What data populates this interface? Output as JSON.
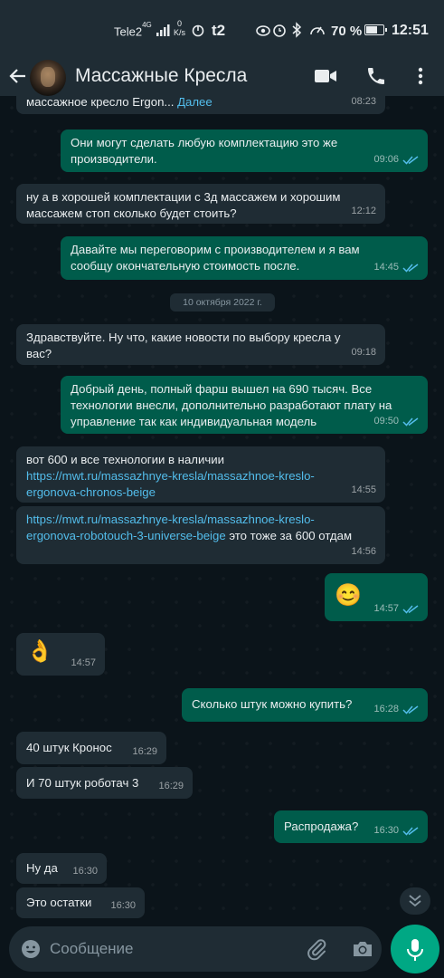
{
  "status_bar": {
    "carrier": "Tele2",
    "network": "4G",
    "speed_value": "0",
    "speed_unit": "K/s",
    "operator2": "t2",
    "battery_percent_label": "70 %",
    "battery_level": 0.7,
    "time": "12:51"
  },
  "header": {
    "title": "Массажные Кресла",
    "icons": [
      "back-arrow-icon",
      "avatar",
      "video-call-icon",
      "phone-icon",
      "menu-dots-icon"
    ]
  },
  "chat": {
    "date_chip": "10 октября 2022 г.",
    "messages": [
      {
        "dir": "in",
        "text": "массажное кресло Ergon... ",
        "link": "Далее",
        "time": "08:23"
      },
      {
        "dir": "out",
        "text": "Они могут сделать любую комплектацию это же производители.",
        "time": "09:06"
      },
      {
        "dir": "in",
        "text": "ну а в хорошей комплектации с 3д массажем и хорошим массажем стоп сколько будет стоить?",
        "time": "12:12"
      },
      {
        "dir": "out",
        "text": "Давайте мы переговорим с производителем и я вам сообщу окончательную стоимость после.",
        "time": "14:45"
      },
      {
        "dir": "in",
        "text": "Здравствуйте. Ну что, какие новости по выбору кресла у вас?",
        "time": "09:18"
      },
      {
        "dir": "out",
        "text": "Добрый день, полный фарш вышел на 690 тысяч. Все технологии внесли, дополнительно разработают плату на управление так как индивидуальная модель",
        "time": "09:50"
      },
      {
        "dir": "in",
        "text": "вот 600 и все технологии в наличии",
        "link": "https://mwt.ru/massazhnye-kresla/massazhnoe-kreslo-ergonova-chronos-beige",
        "time": "14:55"
      },
      {
        "dir": "in",
        "link": "https://mwt.ru/massazhnye-kresla/massazhnoe-kreslo-ergonova-robotouch-3-universe-beige",
        "text": " это тоже за 600 отдам",
        "time": "14:56"
      },
      {
        "dir": "out",
        "text": "😊",
        "time": "14:57"
      },
      {
        "dir": "in",
        "text": "👌",
        "time": "14:57"
      },
      {
        "dir": "out",
        "text": "Сколько штук можно купить?",
        "time": "16:28"
      },
      {
        "dir": "in",
        "text": "40 штук Кронос",
        "time": "16:29"
      },
      {
        "dir": "in",
        "text": "И 70 штук роботач 3",
        "time": "16:29"
      },
      {
        "dir": "out",
        "text": "Распродажа?",
        "time": "16:30"
      },
      {
        "dir": "in",
        "text": "Ну да",
        "time": "16:30"
      },
      {
        "dir": "in",
        "text": "Это остатки",
        "time": "16:30"
      }
    ]
  },
  "composer": {
    "placeholder": "Сообщение",
    "icons": [
      "emoji-icon",
      "attach-icon",
      "camera-icon",
      "mic-icon",
      "scroll-down-icon"
    ]
  },
  "colors": {
    "background": "#0b141a",
    "header": "#1f2c34",
    "incoming_bubble": "#1f2c34",
    "outgoing_bubble": "#005c4b",
    "accent": "#00a884",
    "link": "#53bdeb",
    "read_ticks": "#53bdeb"
  }
}
